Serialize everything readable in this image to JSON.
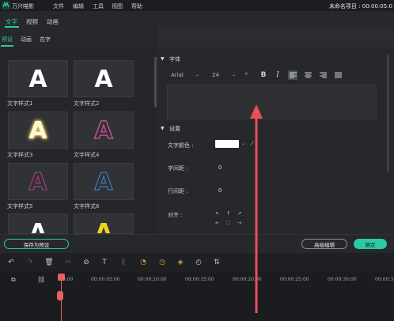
{
  "titlebar": {
    "app_name": "万兴喵影",
    "menus": [
      "文件",
      "编辑",
      "工具",
      "视图",
      "帮助"
    ],
    "project_title": "未命名项目 : 00:00:05:0"
  },
  "top_tabs": [
    "文字",
    "视频",
    "动画"
  ],
  "sub_tabs": [
    "预设",
    "动画",
    "花字"
  ],
  "presets": [
    {
      "label": "文字样式1",
      "letter": "A"
    },
    {
      "label": "文字样式2",
      "letter": "A"
    },
    {
      "label": "文字样式3",
      "letter": "A"
    },
    {
      "label": "文字样式4",
      "letter": "A"
    },
    {
      "label": "文字样式5",
      "letter": "A"
    },
    {
      "label": "文字样式6",
      "letter": "A"
    },
    {
      "label": "",
      "letter": "A"
    },
    {
      "label": "",
      "letter": "A"
    }
  ],
  "font_section": {
    "title": "字体",
    "font_family": "Arial",
    "font_size": "24",
    "style_buttons": [
      "B",
      "I"
    ]
  },
  "settings_section": {
    "title": "设置",
    "text_color_label": "文字颜色 :",
    "text_color": "#ffffff",
    "char_spacing_label": "字间距 :",
    "char_spacing_value": "0",
    "line_spacing_label": "行间距 :",
    "line_spacing_value": "0",
    "align_label": "对齐 :"
  },
  "buttons": {
    "save_preset": "保存为预设",
    "advanced_edit": "高级编辑",
    "confirm": "确定"
  },
  "timeline": {
    "ticks": [
      "00:00",
      "00:00:05:00",
      "00:00:10:00",
      "00:00:15:00",
      "00:00:20:00",
      "00:00:25:00",
      "00:00:30:00",
      "00:00:3"
    ]
  },
  "colors": {
    "accent": "#2ec8a6",
    "playhead": "#e86060",
    "arrow": "#e8505a"
  }
}
